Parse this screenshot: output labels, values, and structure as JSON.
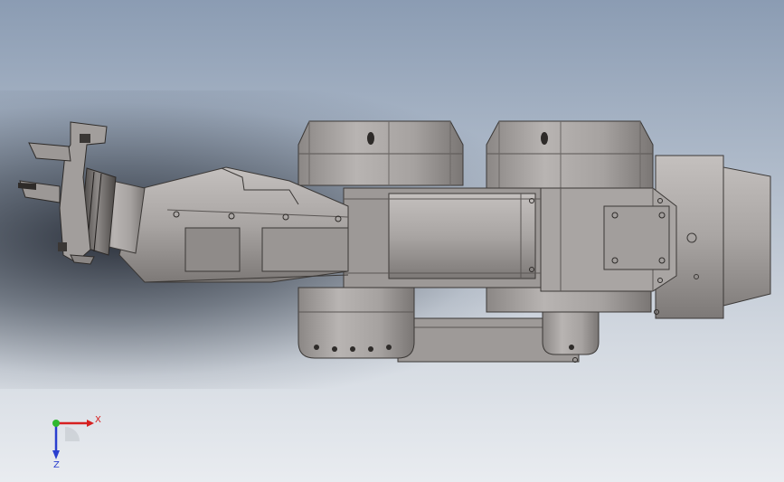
{
  "viewport": {
    "background_top": "#8b9cb3",
    "background_bottom": "#e9ecf0",
    "model_color": "#a8a4a2"
  },
  "triad": {
    "x_label": "X",
    "z_label": "Z",
    "x_color": "#d62020",
    "y_color": "#2fb82f",
    "z_color": "#2a3fcf"
  }
}
